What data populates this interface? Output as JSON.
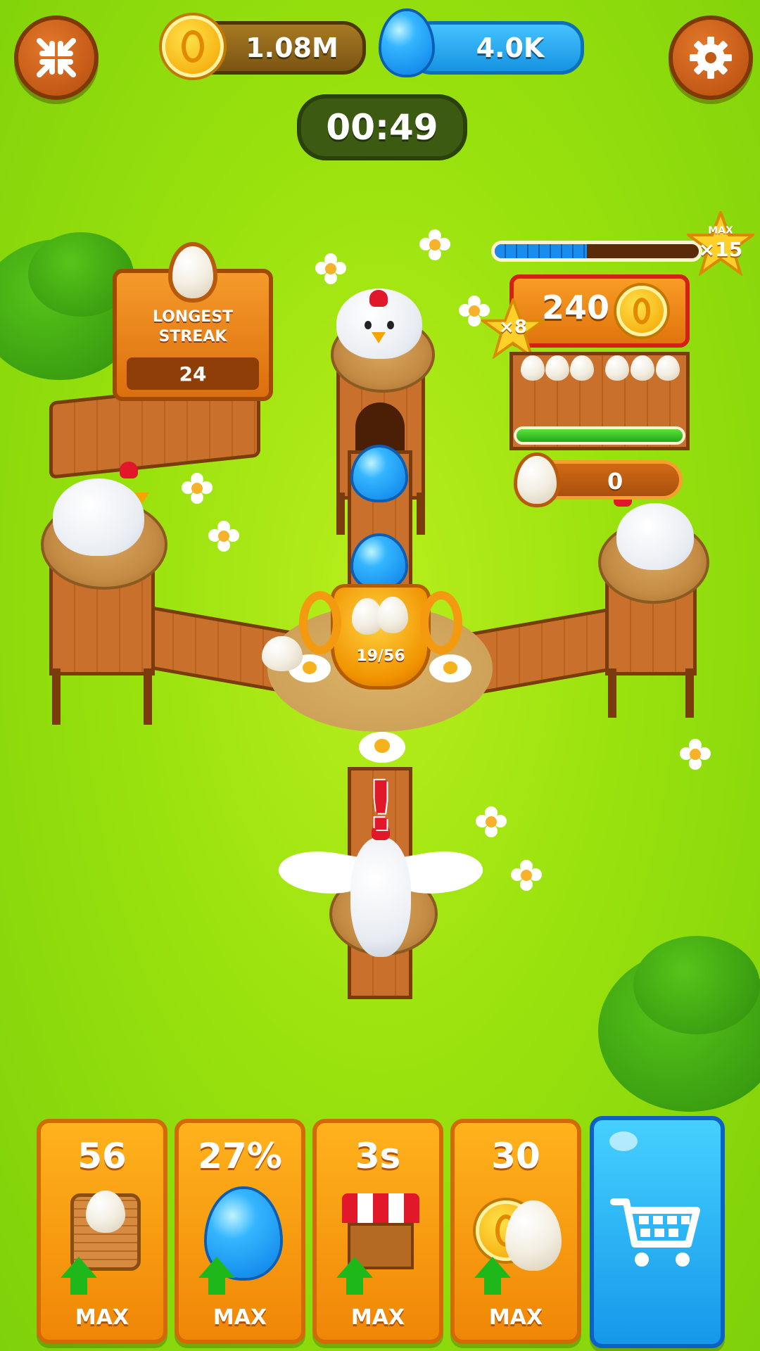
{
  "hud": {
    "coins_value": "1.08M",
    "gems_value": "4.0K",
    "timer": "00:49",
    "collapse_icon": "collapse-arrows-icon",
    "settings_icon": "gear-icon"
  },
  "streak": {
    "label_line1": "LONGEST",
    "label_line2": "STREAK",
    "value": "24"
  },
  "shop_stall": {
    "price": "240",
    "multiplier": "×8",
    "max_label": "MAX",
    "max_multiplier": "×15",
    "progress_fraction": 0.45,
    "egg_count": "0"
  },
  "trophy": {
    "progress": "19/56"
  },
  "alert": "!",
  "upgrades": [
    {
      "value": "56",
      "label": "MAX",
      "icon": "egg-basket-icon"
    },
    {
      "value": "27%",
      "label": "MAX",
      "icon": "blue-egg-icon"
    },
    {
      "value": "3s",
      "label": "MAX",
      "icon": "market-stall-icon"
    },
    {
      "value": "30",
      "label": "MAX",
      "icon": "coin-egg-icon"
    }
  ],
  "shop_button_icon": "cart-icon",
  "colors": {
    "grass": "#9ae20e",
    "orange": "#f59a0e",
    "blue": "#1aa8ef",
    "wood": "#c9702c"
  }
}
